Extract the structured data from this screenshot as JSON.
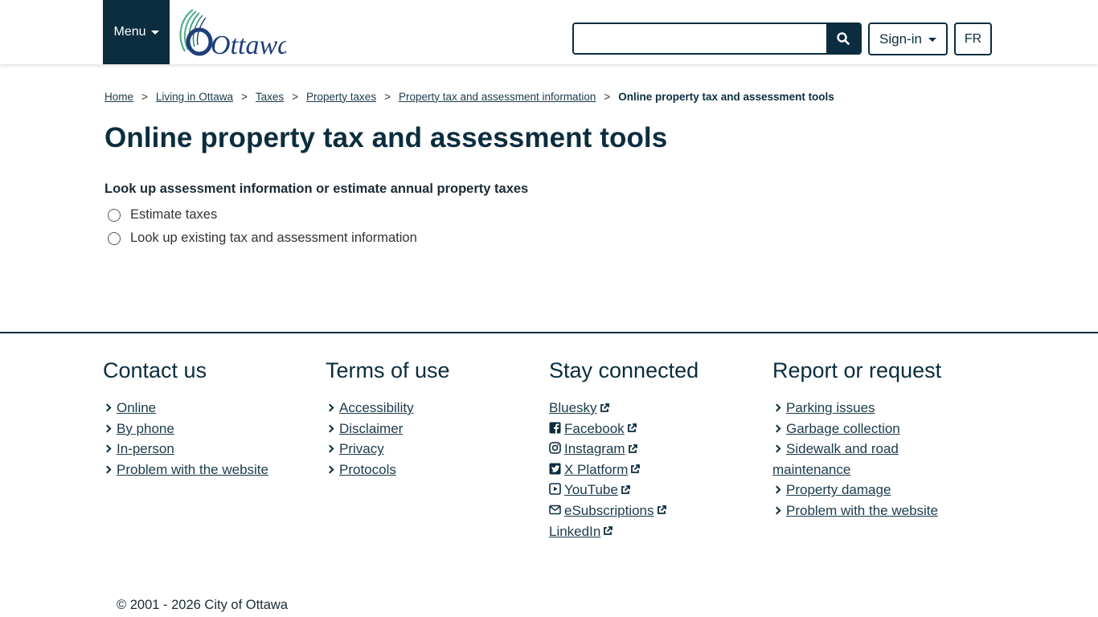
{
  "header": {
    "menu_label": "Menu",
    "logo_text": "Ottawa",
    "search_placeholder": "",
    "signin_label": "Sign-in",
    "language_label": "FR"
  },
  "colors": {
    "brand_dark": "#0b2d3f",
    "logo_blue": "#1f3f7a",
    "logo_green": "#4fae8a"
  },
  "breadcrumb": {
    "items": [
      "Home",
      "Living in Ottawa",
      "Taxes",
      "Property taxes",
      "Property tax and assessment information"
    ],
    "separator": ">",
    "current": "Online property tax and assessment tools"
  },
  "main": {
    "title": "Online property tax and assessment tools",
    "question": "Look up assessment information or estimate annual property taxes",
    "options": [
      "Estimate taxes",
      "Look up existing tax and assessment information"
    ]
  },
  "footer": {
    "contact": {
      "title": "Contact us",
      "items": [
        "Online",
        "By phone",
        "In-person",
        "Problem with the website"
      ]
    },
    "terms": {
      "title": "Terms of use",
      "items": [
        "Accessibility",
        "Disclaimer",
        "Privacy",
        "Protocols"
      ]
    },
    "social": {
      "title": "Stay connected",
      "items": [
        {
          "label": "Bluesky",
          "icon": "none"
        },
        {
          "label": "Facebook",
          "icon": "facebook-icon"
        },
        {
          "label": "Instagram",
          "icon": "instagram-icon"
        },
        {
          "label": "X Platform",
          "icon": "x-icon"
        },
        {
          "label": "YouTube",
          "icon": "youtube-icon"
        },
        {
          "label": "eSubscriptions",
          "icon": "envelope-icon"
        },
        {
          "label": "LinkedIn",
          "icon": "none"
        }
      ]
    },
    "report": {
      "title": "Report or request",
      "items": [
        "Parking issues",
        "Garbage collection",
        "Sidewalk and road maintenance",
        "Property damage",
        "Problem with the website"
      ]
    },
    "copyright": "© 2001 - 2026 City of Ottawa"
  }
}
